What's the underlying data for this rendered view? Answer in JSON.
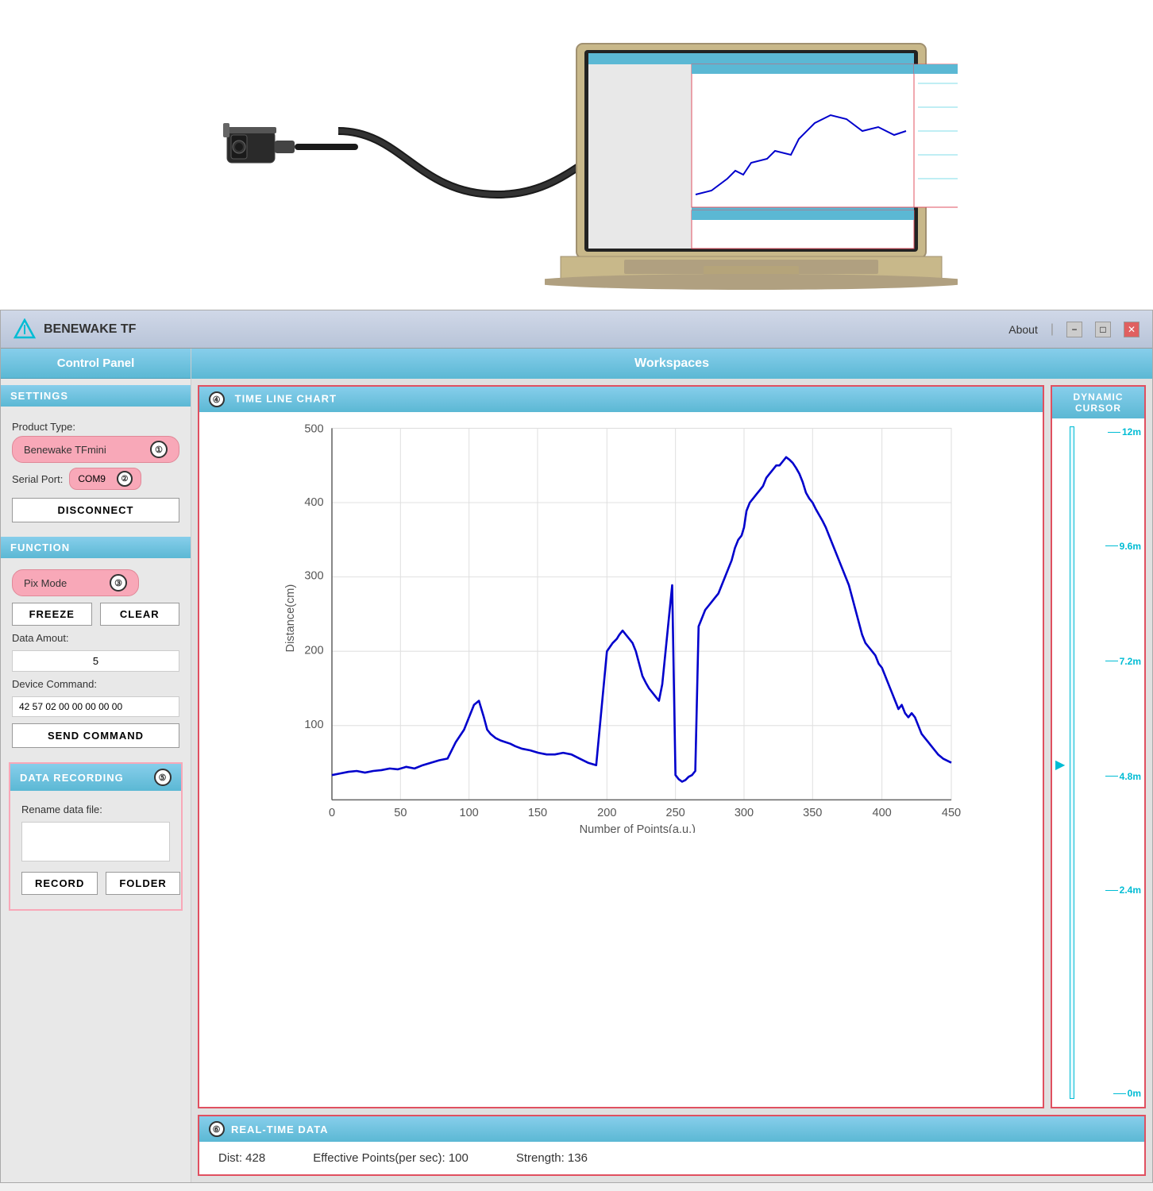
{
  "hero": {
    "alt": "Benewake TF sensor connected to laptop"
  },
  "titlebar": {
    "logo_alt": "Benewake logo",
    "title": "BENEWAKE TF",
    "about": "About",
    "minimize": "−",
    "maximize": "□",
    "close": "✕"
  },
  "control_panel": {
    "header": "Control Panel",
    "settings_label": "SETTINGS",
    "product_type_label": "Product Type:",
    "product_type_value": "Benewake TFmini",
    "product_badge": "①",
    "serial_port_label": "Serial Port:",
    "serial_port_value": "COM9",
    "serial_badge": "②",
    "disconnect_label": "DISCONNECT",
    "function_label": "FUNCTION",
    "pix_mode_value": "Pix Mode",
    "pix_badge": "③",
    "freeze_label": "FREEZE",
    "clear_label": "CLEAR",
    "data_amount_label": "Data Amout:",
    "data_amount_value": "5",
    "device_command_label": "Device Command:",
    "device_command_value": "42 57 02 00 00 00 00 00",
    "send_command_label": "SEND COMMAND",
    "data_recording_label": "DATA RECORDING",
    "data_recording_badge": "⑤",
    "rename_label": "Rename data file:",
    "rename_value": "",
    "record_label": "RECORD",
    "folder_label": "FOLDER"
  },
  "workspace": {
    "header": "Workspaces",
    "chart_label": "TIME LINE CHART",
    "chart_badge": "④",
    "cursor_label": "DYNAMIC CURSOR",
    "cursor_marks": [
      "12m",
      "9.6m",
      "7.2m",
      "4.8m",
      "2.4m",
      "0m"
    ],
    "cursor_position_pct": 52,
    "realtime_label": "REAL-TIME DATA",
    "realtime_badge": "⑥",
    "dist_label": "Dist:",
    "dist_value": "428",
    "effective_label": "Effective Points(per sec):",
    "effective_value": "100",
    "strength_label": "Strength:",
    "strength_value": "136"
  },
  "chart": {
    "y_label": "Distance(cm)",
    "x_label": "Number of Points(a.u.)",
    "y_max": 500,
    "y_ticks": [
      500,
      400,
      300,
      200,
      100
    ],
    "x_ticks": [
      0,
      50,
      100,
      150,
      200,
      250,
      300,
      350,
      400,
      450
    ]
  }
}
